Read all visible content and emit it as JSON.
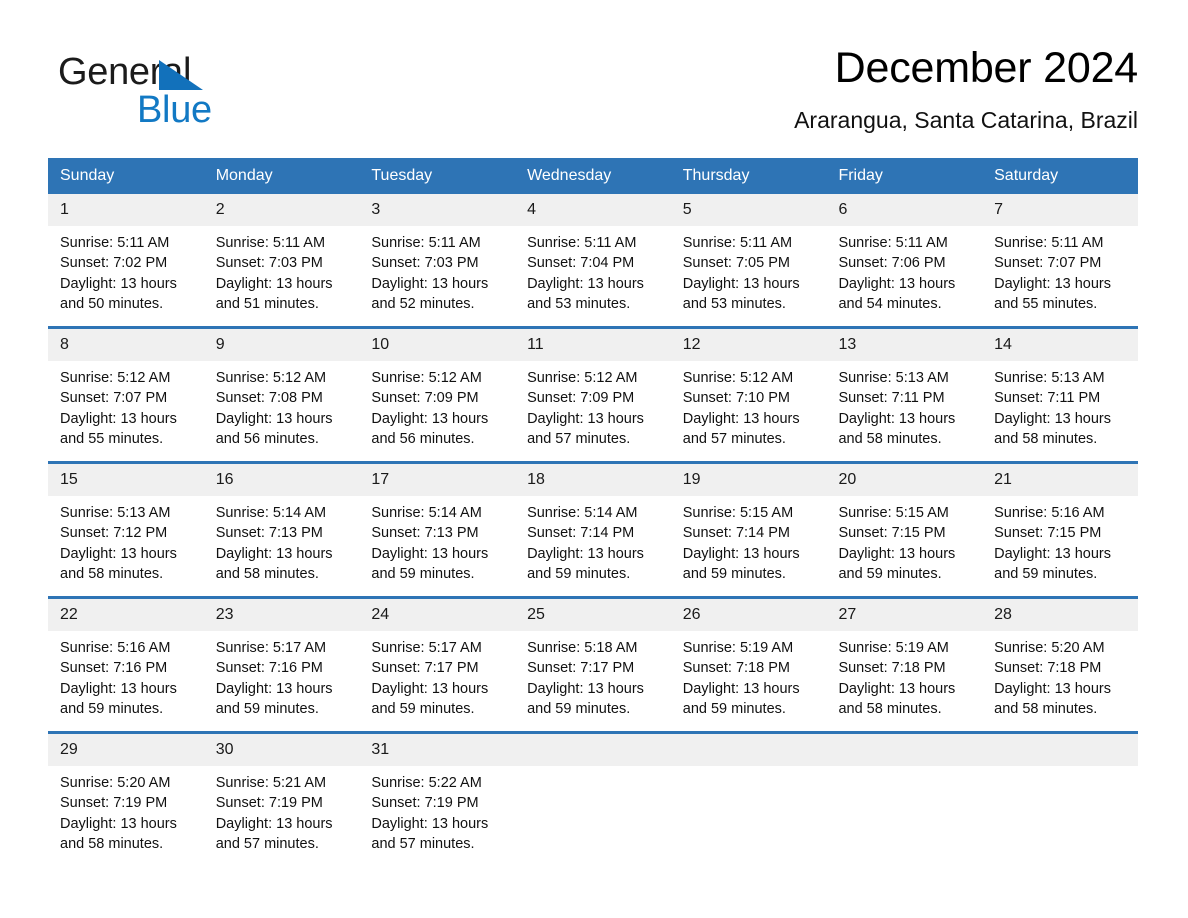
{
  "brand": {
    "name_part1": "General",
    "name_part2": "Blue"
  },
  "header": {
    "title": "December 2024",
    "subtitle": "Ararangua, Santa Catarina, Brazil"
  },
  "theme": {
    "header_blue": "#2e74b5",
    "brand_blue": "#1279c4",
    "daynum_band": "#f0f0f0"
  },
  "weekdays": [
    "Sunday",
    "Monday",
    "Tuesday",
    "Wednesday",
    "Thursday",
    "Friday",
    "Saturday"
  ],
  "labels": {
    "sunrise_prefix": "Sunrise:",
    "sunset_prefix": "Sunset:",
    "daylight_prefix": "Daylight:"
  },
  "weeks": [
    [
      {
        "day": "1",
        "l1": "Sunrise: 5:11 AM",
        "l2": "Sunset: 7:02 PM",
        "l3": "Daylight: 13 hours",
        "l4": "and 50 minutes."
      },
      {
        "day": "2",
        "l1": "Sunrise: 5:11 AM",
        "l2": "Sunset: 7:03 PM",
        "l3": "Daylight: 13 hours",
        "l4": "and 51 minutes."
      },
      {
        "day": "3",
        "l1": "Sunrise: 5:11 AM",
        "l2": "Sunset: 7:03 PM",
        "l3": "Daylight: 13 hours",
        "l4": "and 52 minutes."
      },
      {
        "day": "4",
        "l1": "Sunrise: 5:11 AM",
        "l2": "Sunset: 7:04 PM",
        "l3": "Daylight: 13 hours",
        "l4": "and 53 minutes."
      },
      {
        "day": "5",
        "l1": "Sunrise: 5:11 AM",
        "l2": "Sunset: 7:05 PM",
        "l3": "Daylight: 13 hours",
        "l4": "and 53 minutes."
      },
      {
        "day": "6",
        "l1": "Sunrise: 5:11 AM",
        "l2": "Sunset: 7:06 PM",
        "l3": "Daylight: 13 hours",
        "l4": "and 54 minutes."
      },
      {
        "day": "7",
        "l1": "Sunrise: 5:11 AM",
        "l2": "Sunset: 7:07 PM",
        "l3": "Daylight: 13 hours",
        "l4": "and 55 minutes."
      }
    ],
    [
      {
        "day": "8",
        "l1": "Sunrise: 5:12 AM",
        "l2": "Sunset: 7:07 PM",
        "l3": "Daylight: 13 hours",
        "l4": "and 55 minutes."
      },
      {
        "day": "9",
        "l1": "Sunrise: 5:12 AM",
        "l2": "Sunset: 7:08 PM",
        "l3": "Daylight: 13 hours",
        "l4": "and 56 minutes."
      },
      {
        "day": "10",
        "l1": "Sunrise: 5:12 AM",
        "l2": "Sunset: 7:09 PM",
        "l3": "Daylight: 13 hours",
        "l4": "and 56 minutes."
      },
      {
        "day": "11",
        "l1": "Sunrise: 5:12 AM",
        "l2": "Sunset: 7:09 PM",
        "l3": "Daylight: 13 hours",
        "l4": "and 57 minutes."
      },
      {
        "day": "12",
        "l1": "Sunrise: 5:12 AM",
        "l2": "Sunset: 7:10 PM",
        "l3": "Daylight: 13 hours",
        "l4": "and 57 minutes."
      },
      {
        "day": "13",
        "l1": "Sunrise: 5:13 AM",
        "l2": "Sunset: 7:11 PM",
        "l3": "Daylight: 13 hours",
        "l4": "and 58 minutes."
      },
      {
        "day": "14",
        "l1": "Sunrise: 5:13 AM",
        "l2": "Sunset: 7:11 PM",
        "l3": "Daylight: 13 hours",
        "l4": "and 58 minutes."
      }
    ],
    [
      {
        "day": "15",
        "l1": "Sunrise: 5:13 AM",
        "l2": "Sunset: 7:12 PM",
        "l3": "Daylight: 13 hours",
        "l4": "and 58 minutes."
      },
      {
        "day": "16",
        "l1": "Sunrise: 5:14 AM",
        "l2": "Sunset: 7:13 PM",
        "l3": "Daylight: 13 hours",
        "l4": "and 58 minutes."
      },
      {
        "day": "17",
        "l1": "Sunrise: 5:14 AM",
        "l2": "Sunset: 7:13 PM",
        "l3": "Daylight: 13 hours",
        "l4": "and 59 minutes."
      },
      {
        "day": "18",
        "l1": "Sunrise: 5:14 AM",
        "l2": "Sunset: 7:14 PM",
        "l3": "Daylight: 13 hours",
        "l4": "and 59 minutes."
      },
      {
        "day": "19",
        "l1": "Sunrise: 5:15 AM",
        "l2": "Sunset: 7:14 PM",
        "l3": "Daylight: 13 hours",
        "l4": "and 59 minutes."
      },
      {
        "day": "20",
        "l1": "Sunrise: 5:15 AM",
        "l2": "Sunset: 7:15 PM",
        "l3": "Daylight: 13 hours",
        "l4": "and 59 minutes."
      },
      {
        "day": "21",
        "l1": "Sunrise: 5:16 AM",
        "l2": "Sunset: 7:15 PM",
        "l3": "Daylight: 13 hours",
        "l4": "and 59 minutes."
      }
    ],
    [
      {
        "day": "22",
        "l1": "Sunrise: 5:16 AM",
        "l2": "Sunset: 7:16 PM",
        "l3": "Daylight: 13 hours",
        "l4": "and 59 minutes."
      },
      {
        "day": "23",
        "l1": "Sunrise: 5:17 AM",
        "l2": "Sunset: 7:16 PM",
        "l3": "Daylight: 13 hours",
        "l4": "and 59 minutes."
      },
      {
        "day": "24",
        "l1": "Sunrise: 5:17 AM",
        "l2": "Sunset: 7:17 PM",
        "l3": "Daylight: 13 hours",
        "l4": "and 59 minutes."
      },
      {
        "day": "25",
        "l1": "Sunrise: 5:18 AM",
        "l2": "Sunset: 7:17 PM",
        "l3": "Daylight: 13 hours",
        "l4": "and 59 minutes."
      },
      {
        "day": "26",
        "l1": "Sunrise: 5:19 AM",
        "l2": "Sunset: 7:18 PM",
        "l3": "Daylight: 13 hours",
        "l4": "and 59 minutes."
      },
      {
        "day": "27",
        "l1": "Sunrise: 5:19 AM",
        "l2": "Sunset: 7:18 PM",
        "l3": "Daylight: 13 hours",
        "l4": "and 58 minutes."
      },
      {
        "day": "28",
        "l1": "Sunrise: 5:20 AM",
        "l2": "Sunset: 7:18 PM",
        "l3": "Daylight: 13 hours",
        "l4": "and 58 minutes."
      }
    ],
    [
      {
        "day": "29",
        "l1": "Sunrise: 5:20 AM",
        "l2": "Sunset: 7:19 PM",
        "l3": "Daylight: 13 hours",
        "l4": "and 58 minutes."
      },
      {
        "day": "30",
        "l1": "Sunrise: 5:21 AM",
        "l2": "Sunset: 7:19 PM",
        "l3": "Daylight: 13 hours",
        "l4": "and 57 minutes."
      },
      {
        "day": "31",
        "l1": "Sunrise: 5:22 AM",
        "l2": "Sunset: 7:19 PM",
        "l3": "Daylight: 13 hours",
        "l4": "and 57 minutes."
      },
      {
        "day": "",
        "l1": "",
        "l2": "",
        "l3": "",
        "l4": ""
      },
      {
        "day": "",
        "l1": "",
        "l2": "",
        "l3": "",
        "l4": ""
      },
      {
        "day": "",
        "l1": "",
        "l2": "",
        "l3": "",
        "l4": ""
      },
      {
        "day": "",
        "l1": "",
        "l2": "",
        "l3": "",
        "l4": ""
      }
    ]
  ]
}
